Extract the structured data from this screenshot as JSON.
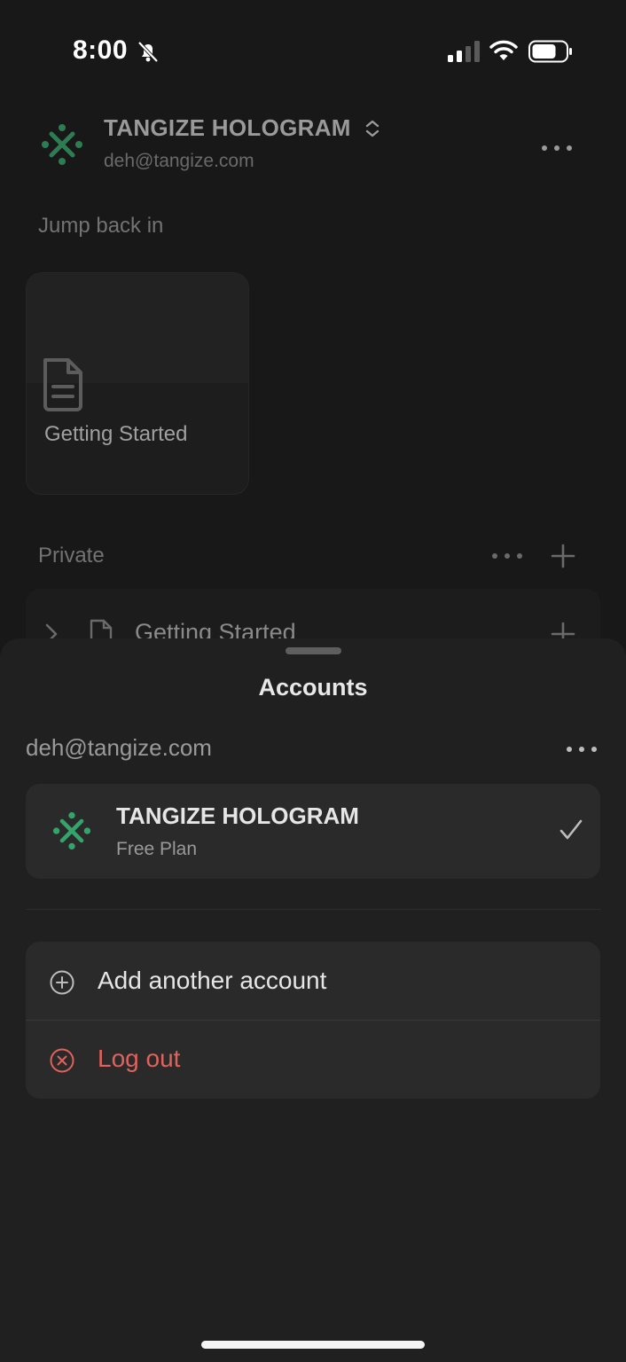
{
  "status_bar": {
    "time": "8:00",
    "icons": [
      "bell-slash-icon",
      "cellular-signal-icon",
      "wifi-icon",
      "battery-icon"
    ]
  },
  "workspace_header": {
    "name": "TANGIZE HOLOGRAM",
    "email": "deh@tangize.com",
    "logo_icon": "workspace-logo-icon",
    "logo_color": "#2e8b57"
  },
  "jump_back_in": {
    "label": "Jump back in",
    "cards": [
      {
        "title": "Getting Started",
        "icon": "document-icon"
      }
    ]
  },
  "private_section": {
    "label": "Private",
    "items": [
      {
        "title": "Getting Started",
        "icon": "document-icon"
      }
    ]
  },
  "accounts_sheet": {
    "title": "Accounts",
    "account_email": "deh@tangize.com",
    "workspaces": [
      {
        "name": "TANGIZE HOLOGRAM",
        "plan": "Free Plan",
        "selected": true
      }
    ],
    "actions": {
      "add_account": "Add another account",
      "log_out": "Log out"
    },
    "colors": {
      "danger": "#e0625c",
      "sheet_bg": "#202020"
    }
  }
}
